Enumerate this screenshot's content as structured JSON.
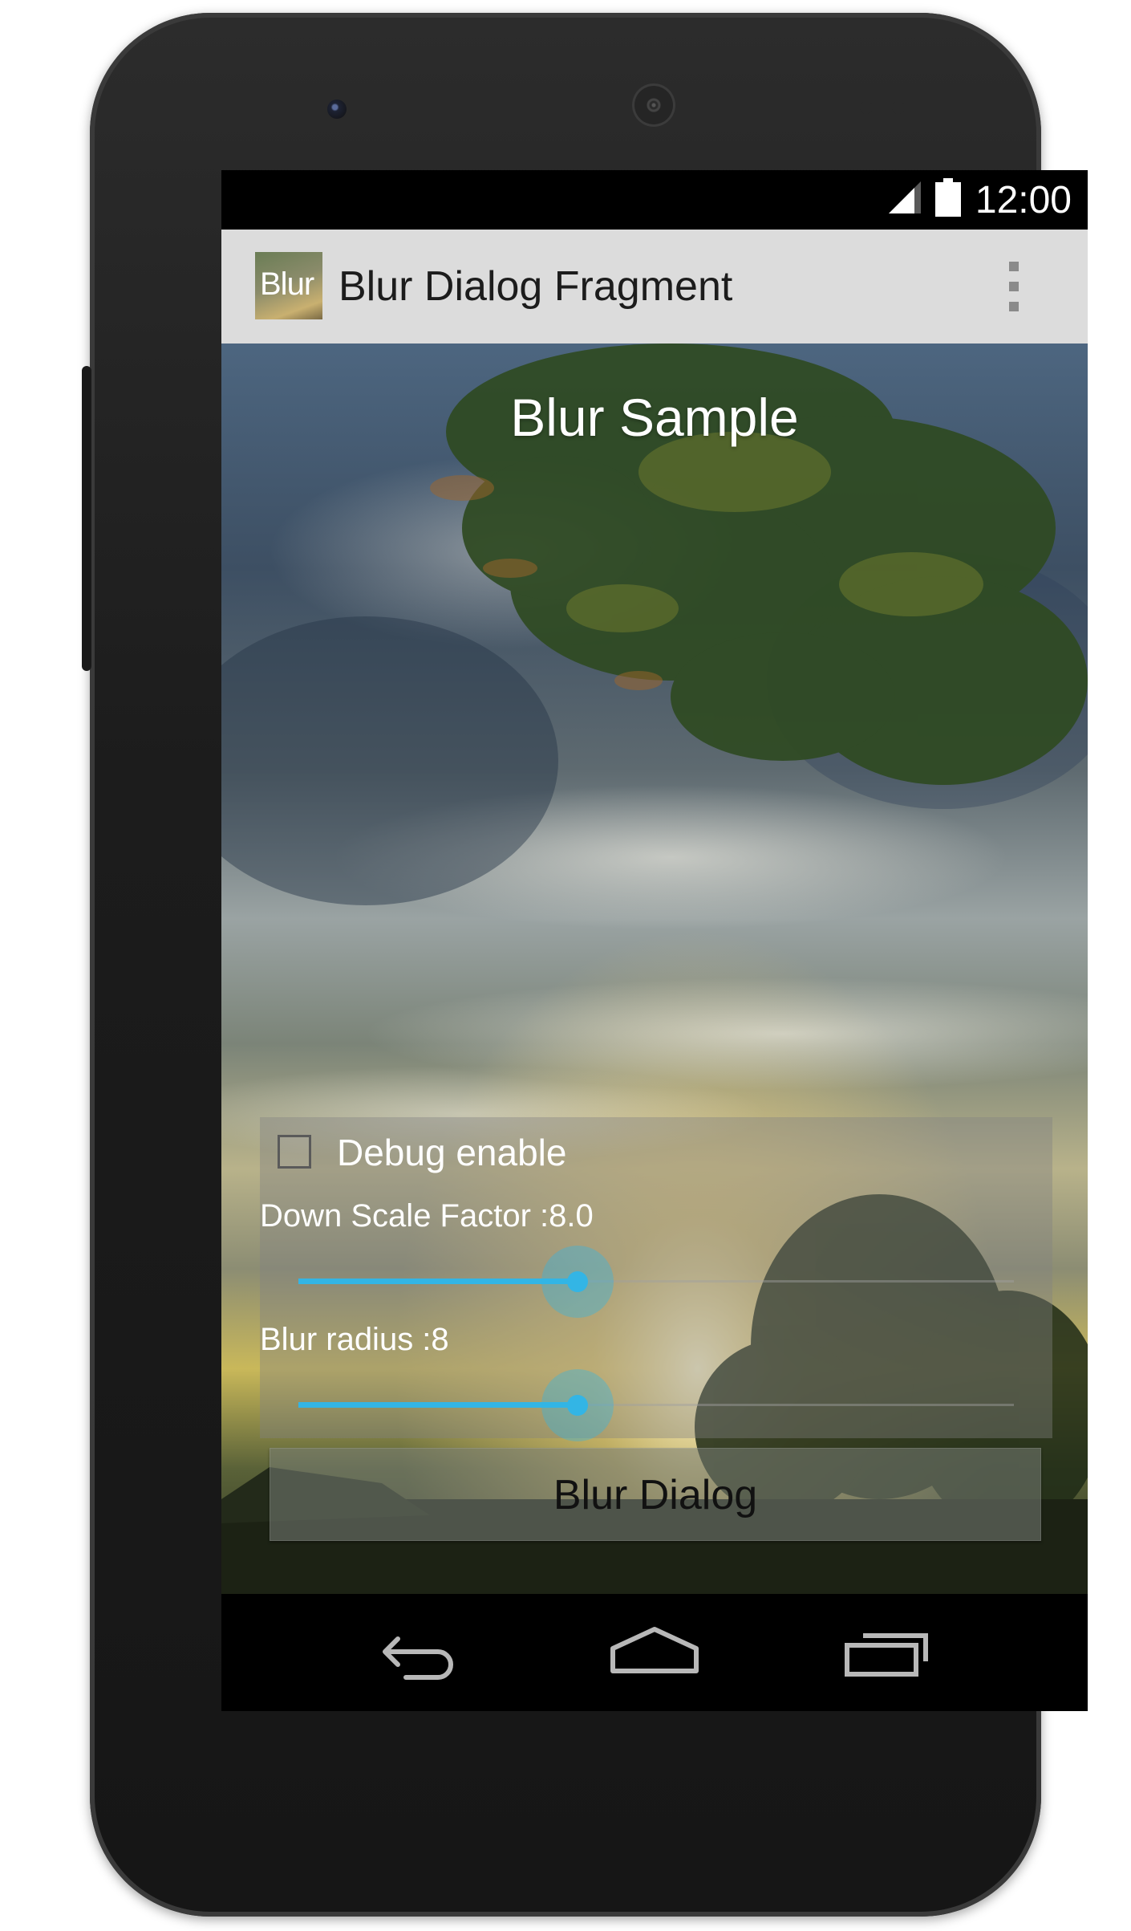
{
  "status_bar": {
    "time": "12:00",
    "signal_icon": "cell-signal-icon",
    "battery_icon": "battery-full-icon"
  },
  "action_bar": {
    "app_icon_text": "Blur",
    "title": "Blur Dialog Fragment",
    "overflow_icon": "overflow-menu-icon"
  },
  "main": {
    "sample_title": "Blur Sample",
    "debug_checkbox": {
      "label": "Debug enable",
      "checked": false
    },
    "down_scale": {
      "label": "Down Scale Factor :8.0",
      "value": 8.0,
      "fraction": 0.39
    },
    "blur_radius": {
      "label": "Blur radius :8",
      "value": 8,
      "fraction": 0.39
    },
    "blur_dialog_button": "Blur Dialog"
  },
  "navigation": {
    "back": "back-icon",
    "home": "home-icon",
    "recents": "recent-apps-icon"
  },
  "colors": {
    "accent": "#33b5e5",
    "action_bar": "#dcdcdc"
  }
}
